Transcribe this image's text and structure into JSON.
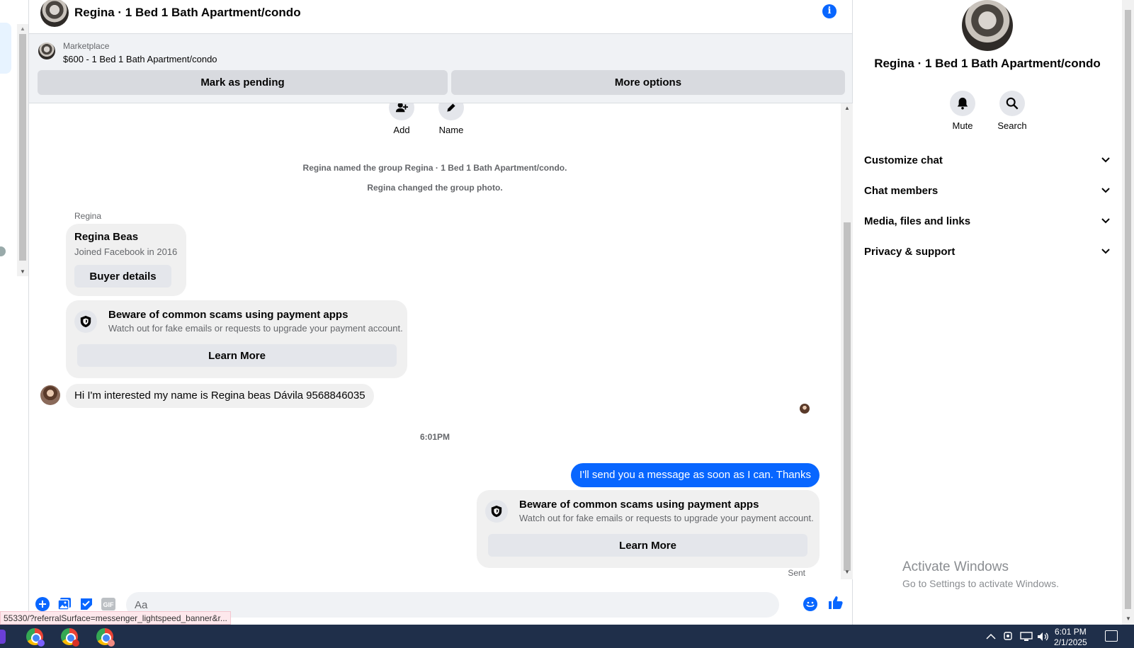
{
  "header": {
    "title": "Regina · 1 Bed 1 Bath Apartment/condo"
  },
  "marketplace": {
    "label": "Marketplace",
    "listing": "$600 - 1 Bed 1 Bath Apartment/condo",
    "mark_pending": "Mark as pending",
    "more_options": "More options"
  },
  "actions": {
    "add": "Add",
    "name": "Name"
  },
  "system_messages": [
    "Regina named the group Regina · 1 Bed 1 Bath Apartment/condo.",
    "Regina changed the group photo."
  ],
  "profile_card": {
    "sender": "Regina",
    "name": "Regina Beas",
    "joined": "Joined Facebook in 2016",
    "button": "Buyer details"
  },
  "scam_warning": {
    "title": "Beware of common scams using payment apps",
    "desc": "Watch out for fake emails or requests to upgrade your payment account.",
    "button": "Learn More"
  },
  "messages": {
    "incoming": "Hi I'm interested my name is Regina beas Dávila 9568846035",
    "timestamp": "6:01PM",
    "outgoing": "I'll send you a message as soon as I can. Thanks",
    "status": "Sent"
  },
  "composer": {
    "placeholder": "Aa"
  },
  "url_tooltip": "55330/?referralSurface=messenger_lightspeed_banner&r...",
  "sidebar": {
    "title": "Regina · 1 Bed 1 Bath Apartment/condo",
    "mute": "Mute",
    "search": "Search",
    "sections": [
      "Customize chat",
      "Chat members",
      "Media, files and links",
      "Privacy & support"
    ]
  },
  "watermark": {
    "line1": "Activate Windows",
    "line2": "Go to Settings to activate Windows."
  },
  "taskbar": {
    "time": "6:01 PM",
    "date": "2/1/2025"
  },
  "colors": {
    "accent": "#0866ff",
    "bubble_in": "#f0f0f0",
    "taskbar": "#1f2f4a"
  },
  "icons": [
    "info-icon",
    "add-person-icon",
    "pencil-icon",
    "shield-icon",
    "plus-circle-icon",
    "photo-icon",
    "sticker-icon",
    "gif-icon",
    "emoji-icon",
    "like-icon",
    "bell-icon",
    "search-icon",
    "chevron-down-icon"
  ]
}
